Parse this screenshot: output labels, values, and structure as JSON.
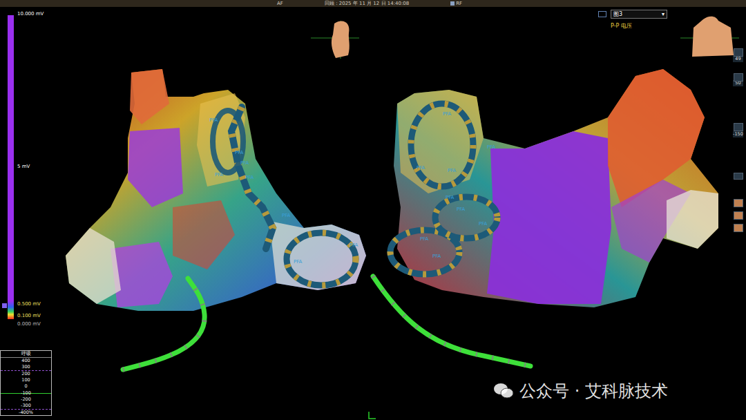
{
  "top_bar": {
    "left": "AF",
    "center": "回顾：2025 年 11 月 12 日 14:40:08",
    "right": "RF"
  },
  "color_scale": {
    "ticks": [
      "10.000 mV",
      "5 mV",
      "0.500 mV",
      "0.100 mV",
      "0.000 mV"
    ]
  },
  "map_selector": {
    "value": "图3",
    "arrow": "▾",
    "label": "P-P 电压"
  },
  "toolbar": {
    "values": [
      "49",
      "50",
      "-150"
    ]
  },
  "respiration": {
    "title": "呼吸",
    "ticks": [
      "400",
      "300",
      "200",
      "100",
      "0",
      "-100",
      "-200",
      "-300",
      "-400%"
    ]
  },
  "views": [
    {
      "name": "left",
      "labels": [
        "PFA",
        "PFA",
        "PFA",
        "PFA",
        "PFA",
        "PFA",
        "PFA",
        "PFA"
      ]
    },
    {
      "name": "right",
      "labels": [
        "PFA",
        "PFA",
        "PFA",
        "PFA",
        "PFA",
        "PFA",
        "PFA",
        "PFA",
        "PFA"
      ]
    }
  ],
  "watermark": "公众号 · 艾科脉技术"
}
